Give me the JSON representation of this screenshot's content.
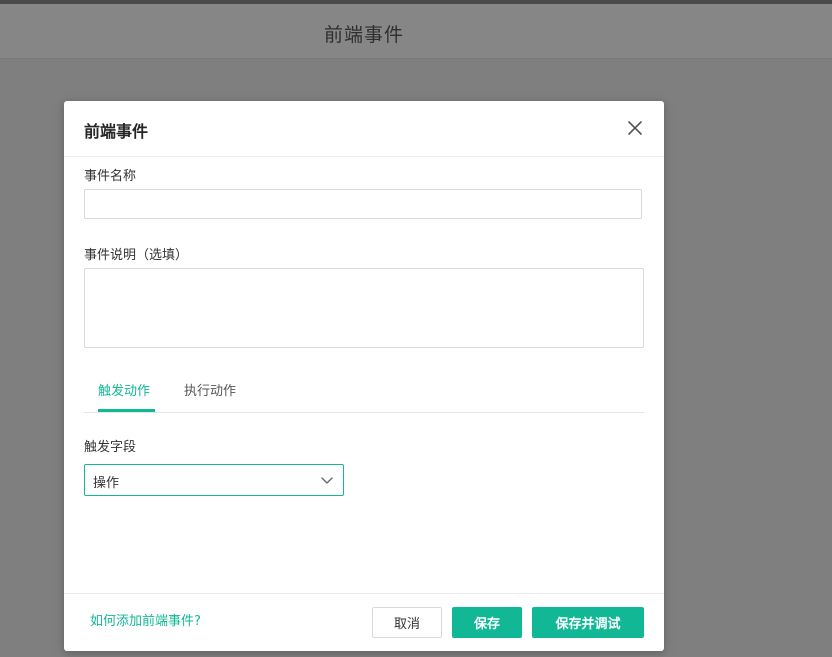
{
  "page": {
    "title": "前端事件"
  },
  "modal": {
    "title": "前端事件",
    "close_icon": "close-icon",
    "fields": {
      "name_label": "事件名称",
      "name_value": "",
      "name_placeholder": "",
      "desc_label": "事件说明（选填）",
      "desc_value": "",
      "desc_placeholder": ""
    },
    "tabs": [
      {
        "label": "触发动作",
        "active": true
      },
      {
        "label": "执行动作",
        "active": false
      }
    ],
    "trigger": {
      "label": "触发字段",
      "selected": "操作",
      "chevron_icon": "chevron-down-icon"
    },
    "footer": {
      "help_link": "如何添加前端事件?",
      "cancel_label": "取消",
      "save_label": "保存",
      "save_debug_label": "保存并调试"
    }
  },
  "colors": {
    "accent": "#12b896",
    "overlay": "#7f7f7f"
  }
}
